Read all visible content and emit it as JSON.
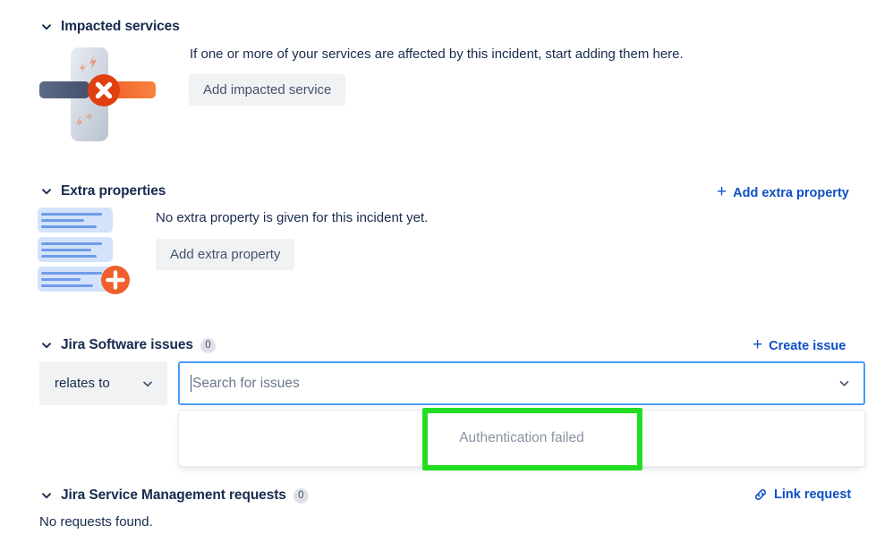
{
  "impacted_services": {
    "title": "Impacted services",
    "chevron_icon": "chevron-down-icon",
    "description": "If one or more of your services are affected by this incident, start adding them here.",
    "button_label": "Add impacted service",
    "illustration_icon": "service-outage-illustration"
  },
  "extra_properties": {
    "title": "Extra properties",
    "chevron_icon": "chevron-down-icon",
    "add_link_label": "Add extra property",
    "add_link_plus": "+",
    "empty_text": "No extra property is given for this incident yet.",
    "button_label": "Add extra property",
    "illustration_icon": "property-list-illustration"
  },
  "jira_software_issues": {
    "title": "Jira Software issues",
    "chevron_icon": "chevron-down-icon",
    "count": "0",
    "create_link_label": "Create issue",
    "create_link_plus": "+",
    "link_type_value": "relates to",
    "link_type_chevron_icon": "chevron-down-icon",
    "search_placeholder": "Search for issues",
    "search_value": "",
    "search_chevron_icon": "chevron-down-icon",
    "dropdown_message": "Authentication failed"
  },
  "jira_service_management_requests": {
    "title": "Jira Service Management requests",
    "chevron_icon": "chevron-down-icon",
    "count": "0",
    "link_label": "Link request",
    "link_icon": "chain-link-icon",
    "empty_text": "No requests found."
  },
  "colors": {
    "link_blue": "#0c4fc4",
    "focus_blue": "#4c9aff",
    "highlight_green": "#22dd22",
    "accent_orange": "#f06a30",
    "text_navy": "#172b4d",
    "muted_grey": "#6b778c"
  }
}
